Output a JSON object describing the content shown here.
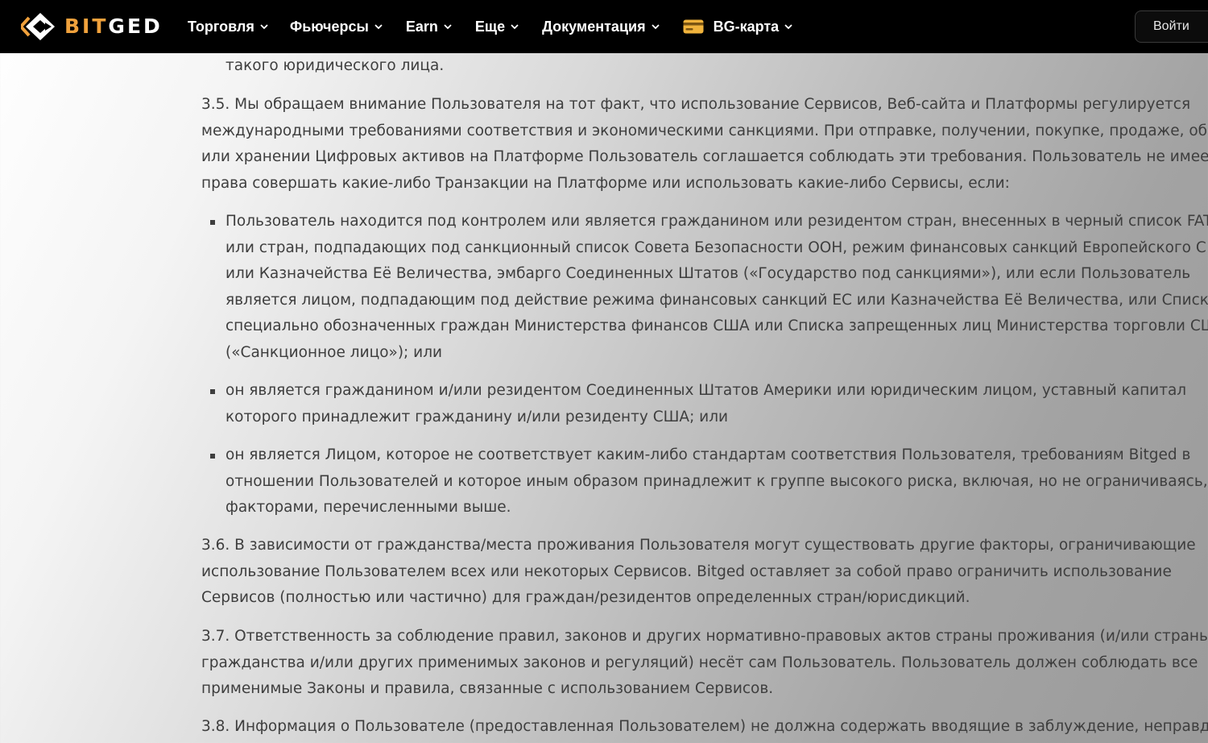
{
  "brand": {
    "logo_part1": "BIT",
    "logo_part2": "GED",
    "accent_color": "#f0a13c"
  },
  "nav": {
    "items": [
      {
        "label": "Торговля"
      },
      {
        "label": "Фьючерсы"
      },
      {
        "label": "Earn"
      },
      {
        "label": "Еще"
      },
      {
        "label": "Документация"
      },
      {
        "label": "BG-карта",
        "icon": "credit-card-icon"
      }
    ],
    "login_label": "Войти"
  },
  "document": {
    "p_prev": [
      "такого юридического лица."
    ],
    "p_3_5": [
      "3.5. Мы обращаем внимание Пользователя на тот факт, что использование Сервисов, Веб-сайта и Платформы регулируется",
      "международными требованиями соответствия и экономическими санкциями. При отправке, получении, покупке, продаже, об",
      "или хранении Цифровых активов на Платформе Пользователь соглашается соблюдать эти требования. Пользователь не имее",
      "права совершать какие-либо Транзакции на Платформе или использовать какие-либо Сервисы, если:"
    ],
    "bullets": [
      [
        "Пользователь находится под контролем или является гражданином или резидентом стран, внесенных в черный список FAT",
        "или стран, подпадающих под санкционный список Совета Безопасности ООН, режим финансовых санкций Европейского С",
        "или Казначейства Её Величества, эмбарго Соединенных Штатов («Государство под санкциями»), или если Пользователь",
        "является лицом, подпадающим под действие режима финансовых санкций ЕС или Казначейства Её Величества, или Списк",
        "специально обозначенных граждан Министерства финансов США или Списка запрещенных лиц Министерства торговли СШ",
        "(«Санкционное лицо»); или"
      ],
      [
        "он является гражданином и/или резидентом Соединенных Штатов Америки или юридическим лицом, уставный капитал",
        "которого принадлежит гражданину и/или резиденту США; или"
      ],
      [
        "он является Лицом, которое не соответствует каким-либо стандартам соответствия Пользователя, требованиям Bitged в",
        "отношении Пользователей и которое иным образом принадлежит к группе высокого риска, включая, но не ограничиваясь,",
        "факторами, перечисленными выше."
      ]
    ],
    "p_3_6": [
      "3.6. В зависимости от гражданства/места проживания Пользователя могут существовать другие факторы, ограничивающие",
      "использование Пользователем всех или некоторых Сервисов. Bitged оставляет за собой право ограничить использование",
      "Сервисов (полностью или частично) для граждан/резидентов определенных стран/юрисдикций."
    ],
    "p_3_7": [
      "3.7. Ответственность за соблюдение правил, законов и других нормативно-правовых актов страны проживания (и/или страны",
      "гражданства и/или других применимых законов и регуляций) несёт сам Пользователь. Пользователь должен соблюдать все",
      "применимые Законы и правила, связанные с использованием Сервисов."
    ],
    "p_3_8": [
      "3.8. Информация о Пользователе (предоставленная Пользователем) не должна содержать вводящие в заблуждение, неправд"
    ]
  }
}
